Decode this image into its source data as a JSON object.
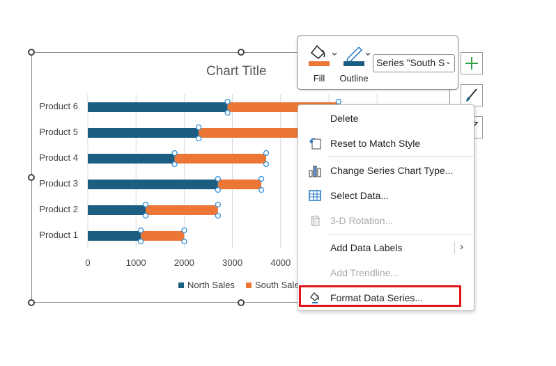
{
  "chart": {
    "title": "Chart Title",
    "legend": [
      {
        "label": "North Sales",
        "color": "#1b5e82"
      },
      {
        "label": "South Sales",
        "color": "#ec7636"
      }
    ]
  },
  "chart_data": {
    "type": "bar",
    "orientation": "horizontal",
    "stacked": true,
    "title": "Chart Title",
    "categories": [
      "Product 1",
      "Product 2",
      "Product 3",
      "Product 4",
      "Product 5",
      "Product 6"
    ],
    "series": [
      {
        "name": "North Sales",
        "values": [
          1100,
          1200,
          2700,
          1800,
          2300,
          2900
        ],
        "color": "#1b5e82"
      },
      {
        "name": "South Sales",
        "values": [
          900,
          1500,
          900,
          1900,
          2800,
          2300
        ],
        "color": "#ec7636"
      }
    ],
    "x_ticks": [
      "0",
      "1000",
      "2000",
      "3000",
      "4000"
    ],
    "xlim": [
      0,
      7000
    ],
    "grid": true,
    "legend_position": "bottom"
  },
  "mini_toolbar": {
    "fill_label": "Fill",
    "outline_label": "Outline",
    "series_select_value": "Series \"South S",
    "fill_color": "#ec7636",
    "outline_color": "#1b5e82"
  },
  "context_menu": {
    "items": [
      {
        "label": "Delete",
        "icon": "none"
      },
      {
        "label": "Reset to Match Style",
        "icon": "reset-style-icon"
      },
      {
        "label": "Change Series Chart Type...",
        "icon": "bar-chart-icon"
      },
      {
        "label": "Select Data...",
        "icon": "table-grid-icon"
      },
      {
        "label": "3-D Rotation...",
        "icon": "cube-icon",
        "disabled": true
      },
      {
        "label": "Add Data Labels",
        "icon": "none",
        "submenu": true
      },
      {
        "label": "Add Trendline...",
        "icon": "none",
        "disabled": true
      },
      {
        "label": "Format Data Series...",
        "icon": "paint-bucket-icon"
      }
    ]
  }
}
